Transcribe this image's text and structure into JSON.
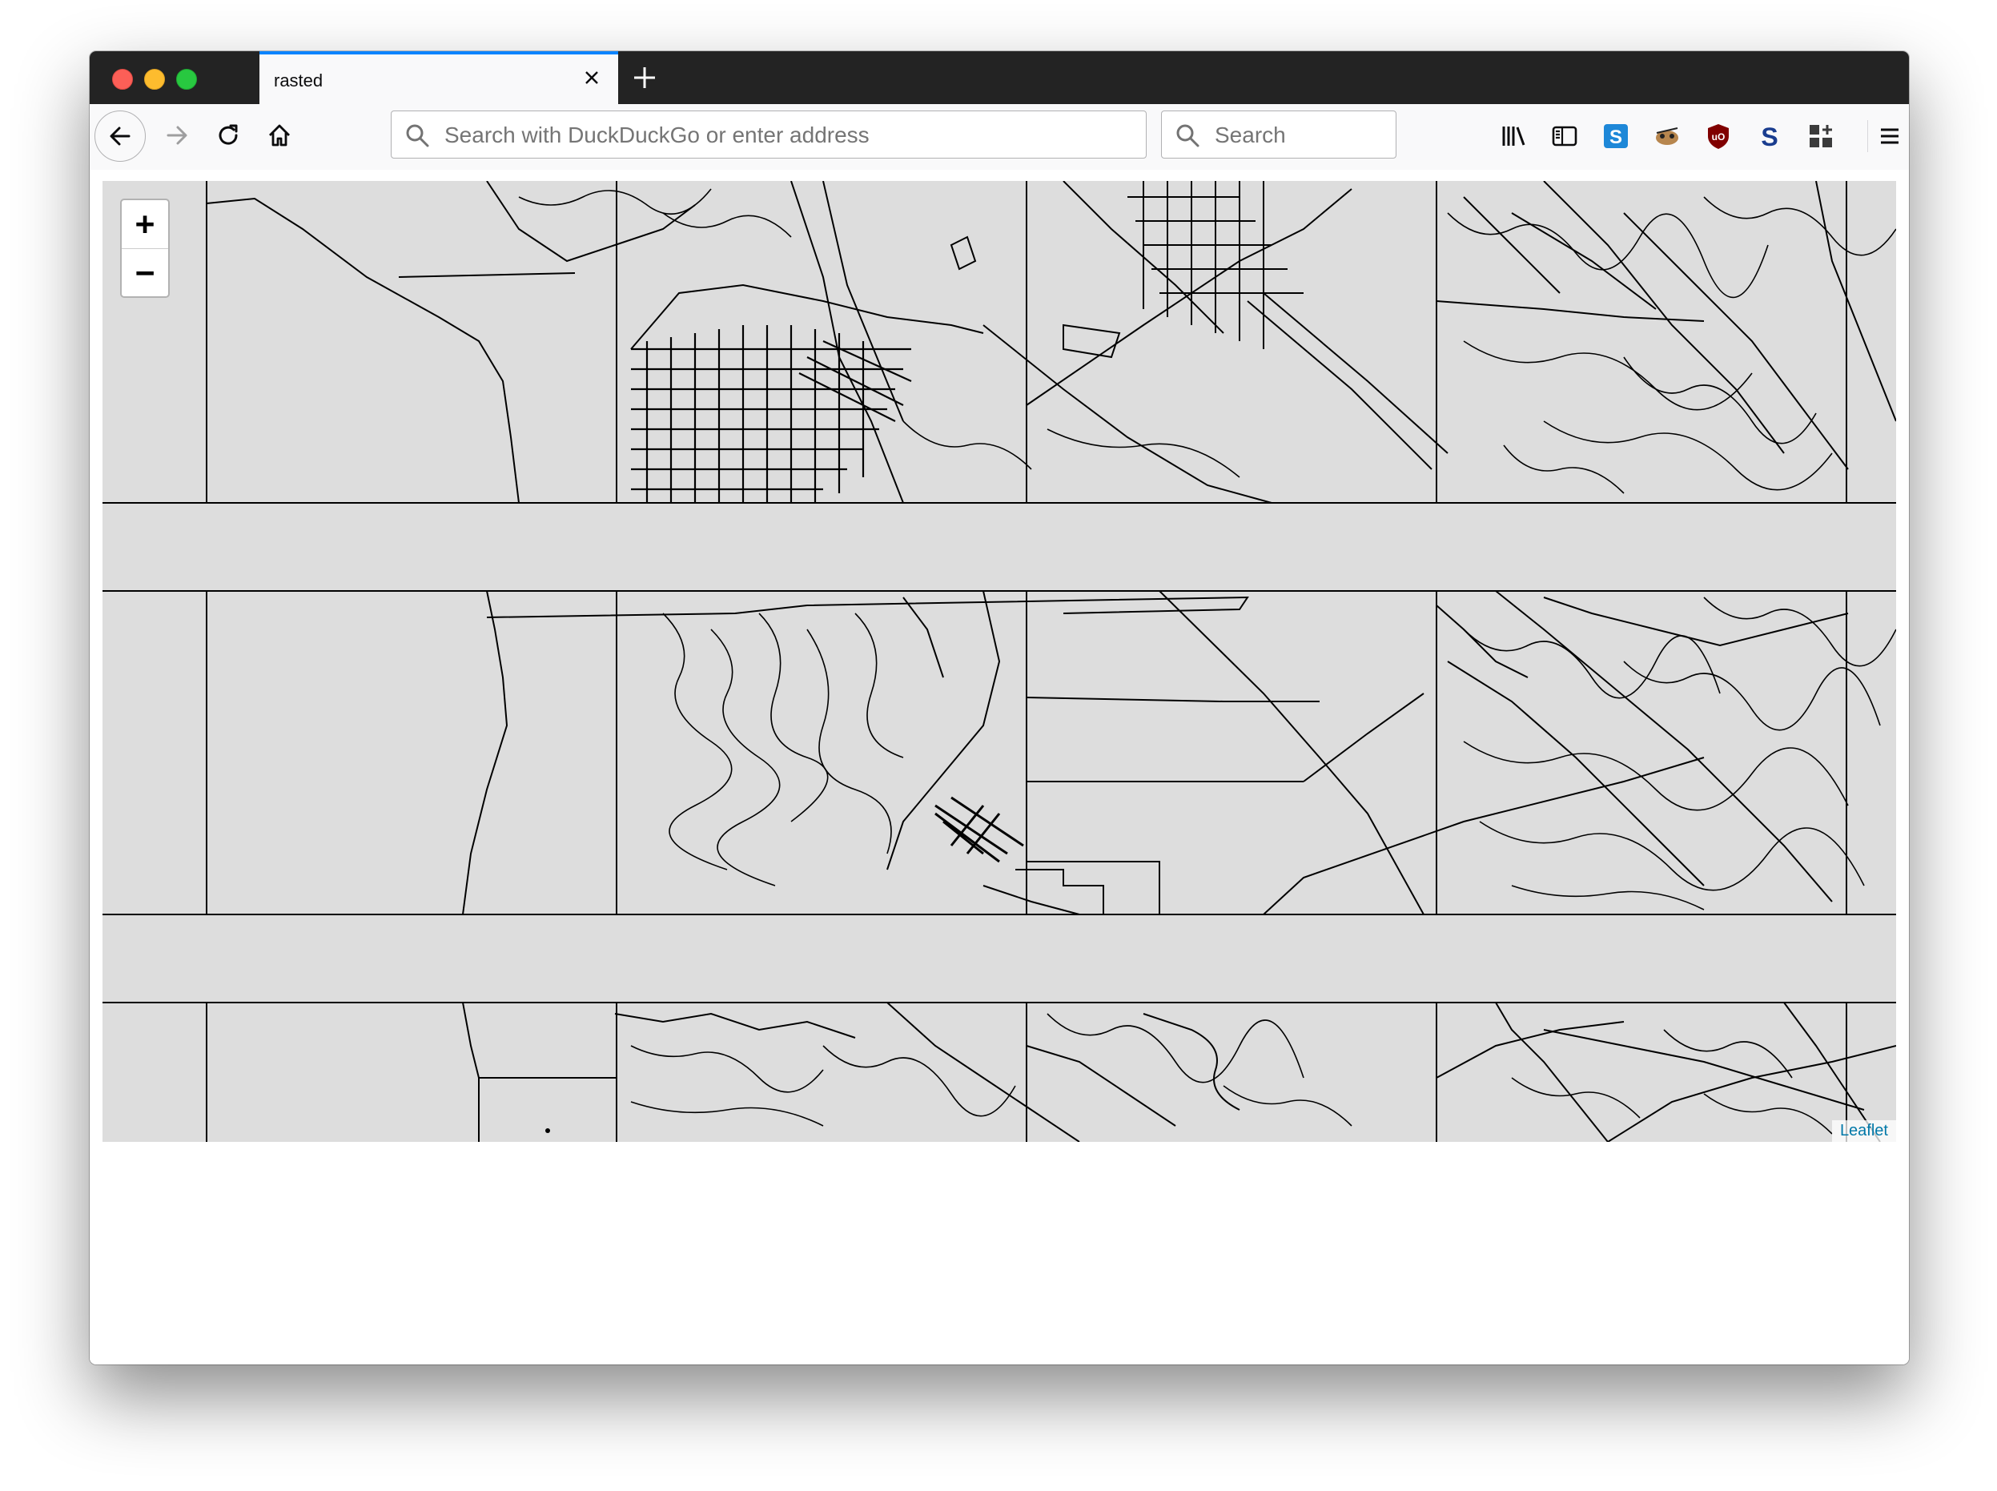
{
  "browser": {
    "tab_title": "rasted",
    "address_placeholder": "Search with DuckDuckGo or enter address",
    "search_placeholder": "Search",
    "toolbar_icons": [
      "library-icon",
      "sidebar-icon",
      "skype-extension-icon",
      "sloth-extension-icon",
      "ublock-origin-icon",
      "s-extension-icon",
      "add-ons-icon",
      "menu-icon"
    ]
  },
  "map": {
    "zoom_in_label": "+",
    "zoom_out_label": "−",
    "attribution": "Leaflet",
    "background_color": "#dddddd",
    "line_color": "#000000"
  },
  "colors": {
    "accent": "#0a84ff",
    "titlebar": "#232323",
    "toolbar": "#f9f9fa"
  }
}
